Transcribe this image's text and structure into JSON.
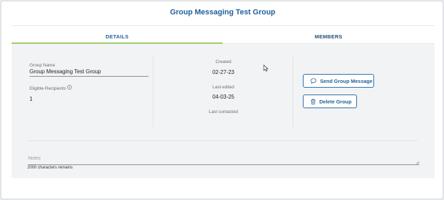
{
  "header": {
    "title": "Group Messaging Test Group"
  },
  "tabs": [
    {
      "label": "DETAILS",
      "active": true
    },
    {
      "label": "MEMBERS",
      "active": false
    }
  ],
  "details": {
    "group_name_label": "Group Name",
    "group_name_value": "Group Messaging Test Group",
    "eligible_label": "Eligible Recipients",
    "eligible_value": "1",
    "created_label": "Created",
    "created_value": "02-27-23",
    "last_edited_label": "Last edited",
    "last_edited_value": "04-03-25",
    "last_contacted_label": "Last contacted",
    "last_contacted_value": ""
  },
  "actions": {
    "send_label": "Send Group Message",
    "delete_label": "Delete Group"
  },
  "notes": {
    "placeholder": "Notes",
    "remaining": "2000 characters remains"
  },
  "colors": {
    "accent": "#1f5f99",
    "tab_indicator": "#9ccc65",
    "panel_bg": "#f2f3f5"
  },
  "icons": {
    "send": "chat-bubble-icon",
    "delete": "trash-icon",
    "info": "info-icon"
  }
}
